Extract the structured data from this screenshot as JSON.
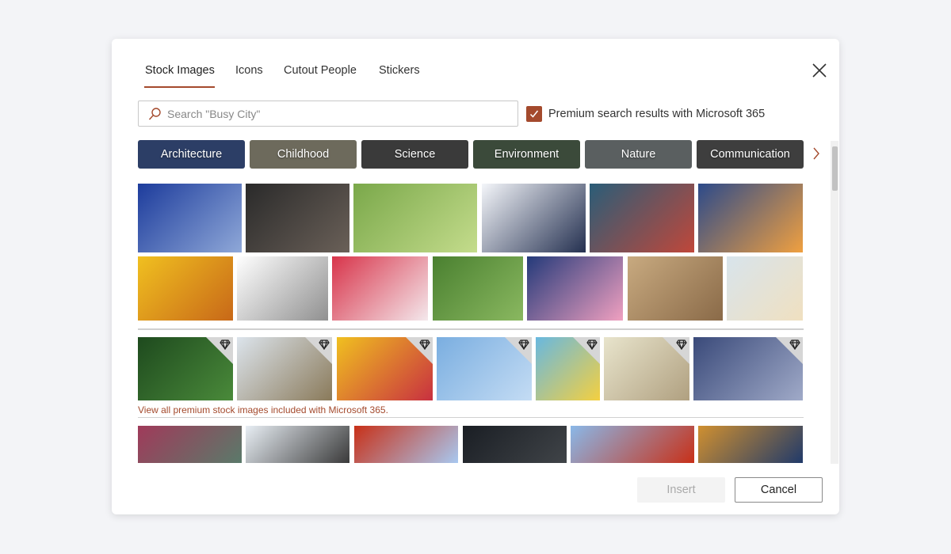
{
  "tabs": [
    {
      "label": "Stock Images",
      "active": true
    },
    {
      "label": "Icons"
    },
    {
      "label": "Cutout People"
    },
    {
      "label": "Stickers"
    }
  ],
  "search": {
    "placeholder": "Search \"Busy City\"",
    "value": ""
  },
  "premium_checkbox": {
    "label": "Premium search results with Microsoft 365",
    "checked": true
  },
  "categories": [
    {
      "label": "Architecture",
      "color": "#2c3e66"
    },
    {
      "label": "Childhood",
      "color": "#6d6a5c"
    },
    {
      "label": "Science",
      "color": "#3a3a3a"
    },
    {
      "label": "Environment",
      "color": "#3b4a3a"
    },
    {
      "label": "Nature",
      "color": "#5a5f60"
    },
    {
      "label": "Communication",
      "color": "#3e3e3e"
    }
  ],
  "tiles": {
    "row1": [
      [
        "#1d3c9c",
        "#8fa8d8"
      ],
      [
        "#2a2a2a",
        "#6a6058"
      ],
      [
        "#7aa84a",
        "#c4dc8c"
      ],
      [
        "#f4f6fa",
        "#243050"
      ],
      [
        "#2a5d78",
        "#c0473a"
      ],
      [
        "#2c4a8a",
        "#f0a040"
      ]
    ],
    "row2": [
      [
        "#f0c020",
        "#c86818"
      ],
      [
        "#ffffff",
        "#909090"
      ],
      [
        "#d8344a",
        "#f4e8ec"
      ],
      [
        "#4a8030",
        "#8ab860"
      ],
      [
        "#243a7a",
        "#f0a0c0"
      ],
      [
        "#c8aa80",
        "#8a6a48"
      ],
      [
        "#d8e4ec",
        "#f0e0c0"
      ]
    ],
    "premium": [
      [
        "#1e4a1e",
        "#4a8a3a"
      ],
      [
        "#dce4ec",
        "#8a7a5a"
      ],
      [
        "#f0c020",
        "#c83040"
      ],
      [
        "#7aaee0",
        "#c4dcf4"
      ],
      [
        "#68b8e0",
        "#f4d040"
      ],
      [
        "#e8e4cc",
        "#b0a080"
      ],
      [
        "#3a4a7a",
        "#a0aac8"
      ]
    ],
    "row4": [
      [
        "#a03a5a",
        "#5a7a6a"
      ],
      [
        "#e8eef4",
        "#3a3a3a"
      ],
      [
        "#c83018",
        "#a8c8f0"
      ],
      [
        "#1a1e24",
        "#404448"
      ],
      [
        "#8ab8e8",
        "#c83018"
      ],
      [
        "#d09030",
        "#203a6a"
      ]
    ]
  },
  "premium_link": "View all premium stock images included with Microsoft 365.",
  "buttons": {
    "insert": "Insert",
    "cancel": "Cancel"
  },
  "accent": "#a44a2d"
}
